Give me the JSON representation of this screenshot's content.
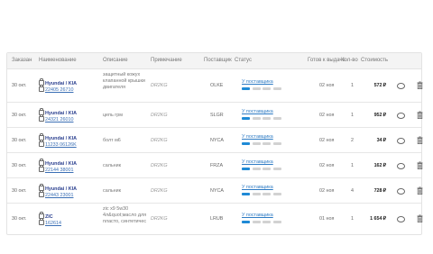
{
  "columns": {
    "date": "Заказан",
    "name": "Наименование",
    "desc": "Описание",
    "note": "Примечание",
    "supplier": "Поставщик",
    "status": "Статус",
    "ready": "Готов к выдаче",
    "qty": "Кол-во",
    "cost": "Стоимость"
  },
  "rows": [
    {
      "date": "30 окт.",
      "brand": "Hyundai / KIA",
      "article": "22405 26710",
      "desc": "защитный кожух клапанной крышки двигателя",
      "note": "DR2KG",
      "supplier": "OLKE",
      "status": "У поставщика",
      "ready": "02 ноя",
      "qty": "1",
      "price": "572",
      "currency": "₽"
    },
    {
      "date": "30 окт.",
      "brand": "Hyundai / KIA",
      "article": "24321 26010",
      "desc": "цепь грм",
      "note": "DR2KG",
      "supplier": "SLGR",
      "status": "У поставщика",
      "ready": "02 ноя",
      "qty": "1",
      "price": "952",
      "currency": "₽"
    },
    {
      "date": "30 окт.",
      "brand": "Hyundai / KIA",
      "article": "11233 06126K",
      "desc": "болт м6",
      "note": "DR2KG",
      "supplier": "NYCA",
      "status": "У поставщика",
      "ready": "02 ноя",
      "qty": "2",
      "price": "34",
      "currency": "₽"
    },
    {
      "date": "30 окт.",
      "brand": "Hyundai / KIA",
      "article": "22144 38001",
      "desc": "сальник",
      "note": "DR2KG",
      "supplier": "FRZA",
      "status": "У поставщика",
      "ready": "02 ноя",
      "qty": "1",
      "price": "162",
      "currency": "₽"
    },
    {
      "date": "30 окт.",
      "brand": "Hyundai / KIA",
      "article": "22443 23001",
      "desc": "сальник",
      "note": "DR2KG",
      "supplier": "NYCA",
      "status": "У поставщика",
      "ready": "02 ноя",
      "qty": "4",
      "price": "728",
      "currency": "₽"
    },
    {
      "date": "30 окт.",
      "brand": "ZIC",
      "article": "162614",
      "desc": "zic x9 5w30 4л&quot;масло для пласто, синтетичес",
      "note": "DR2KG",
      "supplier": "LRUB",
      "status": "У поставщика",
      "ready": "01 ноя",
      "qty": "1",
      "price": "1 654",
      "currency": "₽"
    }
  ],
  "icons": {
    "chat": "chat-bubble-icon",
    "trash": "trash-icon",
    "lock": "lock-icon"
  },
  "colors": {
    "accent": "#1f8ad6",
    "link": "#3b6fb5",
    "brand": "#2a3f8f"
  }
}
